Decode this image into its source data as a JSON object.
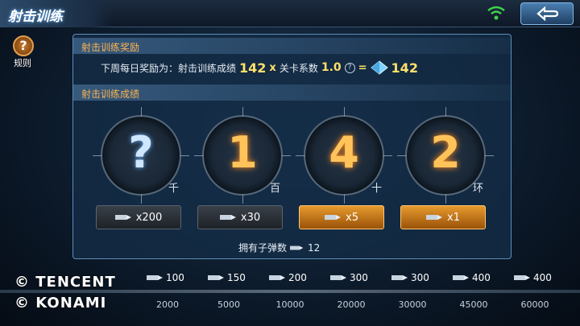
{
  "header": {
    "title": "射击训练"
  },
  "rules": {
    "label": "规则",
    "icon": "help-icon"
  },
  "reward_section": {
    "heading": "射击训练奖励",
    "prefix": "下周每日奖励为：射击训练成绩",
    "score": "142",
    "times": "x",
    "factor_label": "关卡系数",
    "factor": "1.0",
    "equals": "=",
    "result": "142"
  },
  "score_section": {
    "heading": "射击训练成绩",
    "digits": [
      {
        "value": "?",
        "unit": "千"
      },
      {
        "value": "1",
        "unit": "百"
      },
      {
        "value": "4",
        "unit": "十"
      },
      {
        "value": "2",
        "unit": "环"
      }
    ],
    "bets": [
      "x200",
      "x30",
      "x5",
      "x1"
    ],
    "ammo_label": "拥有子弹数",
    "ammo_count": "12"
  },
  "track": {
    "rewards": [
      "100",
      "150",
      "200",
      "300",
      "300",
      "400",
      "400"
    ],
    "thresholds": [
      "2000",
      "5000",
      "10000",
      "20000",
      "30000",
      "45000",
      "60000"
    ]
  },
  "watermark": {
    "line1": "© TENCENT",
    "line2": "© KONAMI"
  },
  "colors": {
    "accent_orange": "#ffc35a",
    "digit_blue": "#cfe6ff",
    "panel_border": "#5d8db8"
  }
}
